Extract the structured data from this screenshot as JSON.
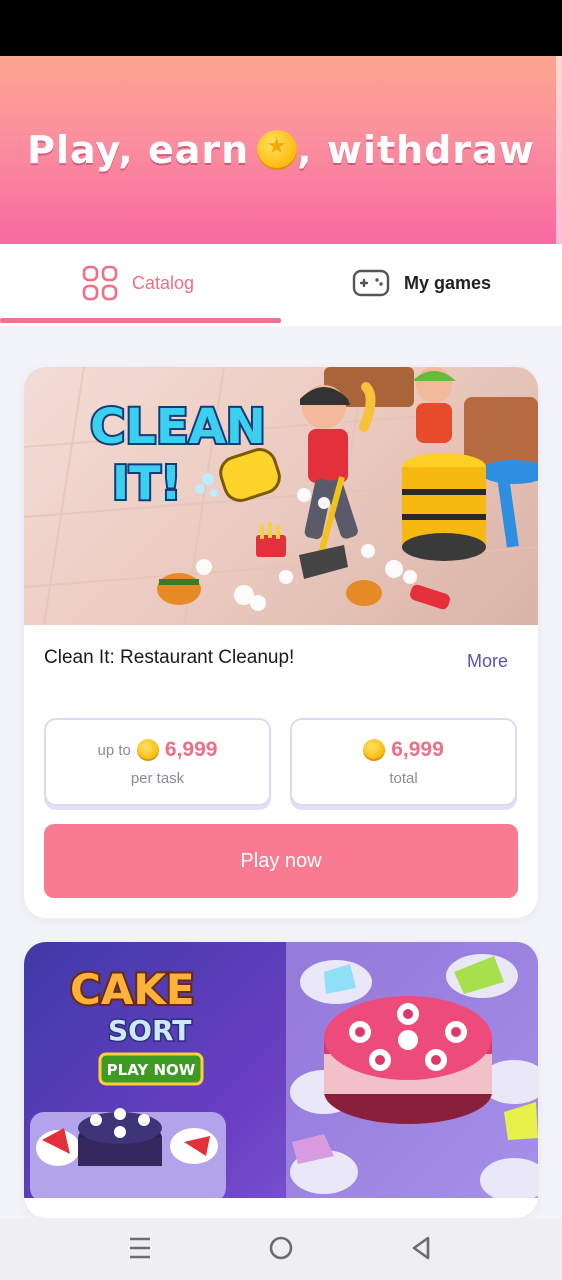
{
  "hero": {
    "title_part1": "Play, earn",
    "title_part2": ", withdraw",
    "coin_icon": "coin-star-icon"
  },
  "tabs": [
    {
      "label": "Catalog",
      "icon": "grid-icon",
      "active": true
    },
    {
      "label": "My games",
      "icon": "gamepad-icon",
      "active": false
    }
  ],
  "games": [
    {
      "banner_text": "CLEAN IT!",
      "title": "Clean It: Restaurant Cleanup!",
      "more_label": "More",
      "reward_task": {
        "prefix": "up to",
        "amount": "6,999",
        "caption": "per task"
      },
      "reward_total": {
        "amount": "6,999",
        "caption": "total"
      },
      "play_label": "Play now"
    },
    {
      "banner_text_1": "CAKE",
      "banner_text_2": "SORT",
      "banner_button": "PLAY NOW"
    }
  ],
  "colors": {
    "accent": "#ef6f87",
    "button": "#f97b92",
    "link": "#5a52b8",
    "coin": "#ffc21a"
  },
  "navbar": [
    {
      "icon": "menu-icon"
    },
    {
      "icon": "home-circle-icon"
    },
    {
      "icon": "back-triangle-icon"
    }
  ]
}
